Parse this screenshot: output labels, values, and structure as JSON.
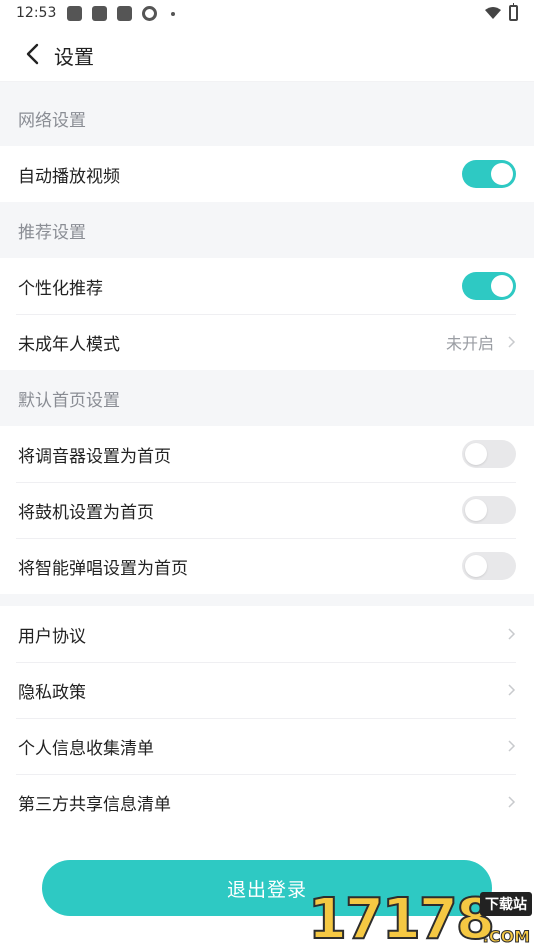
{
  "status_bar": {
    "time": "12:53"
  },
  "header": {
    "title": "设置"
  },
  "sections": {
    "network": {
      "title": "网络设置",
      "autoplay": {
        "label": "自动播放视频",
        "toggle_on": true
      }
    },
    "recommend": {
      "title": "推荐设置",
      "personalized": {
        "label": "个性化推荐",
        "toggle_on": true
      },
      "minor_mode": {
        "label": "未成年人模式",
        "value": "未开启"
      }
    },
    "default_home": {
      "title": "默认首页设置",
      "tuner": {
        "label": "将调音器设置为首页",
        "toggle_on": false
      },
      "drum": {
        "label": "将鼓机设置为首页",
        "toggle_on": false
      },
      "sing": {
        "label": "将智能弹唱设置为首页",
        "toggle_on": false
      }
    },
    "legal": {
      "user_agreement": "用户协议",
      "privacy_policy": "隐私政策",
      "personal_info_list": "个人信息收集清单",
      "third_party_list": "第三方共享信息清单"
    }
  },
  "logout_button": "退出登录",
  "watermark": {
    "number": "17178",
    "tag": "下载站",
    "suffix": ".COM"
  },
  "colors": {
    "accent": "#2ec9c3",
    "section_bg": "#f5f6f8",
    "section_text": "#8a8d94"
  }
}
